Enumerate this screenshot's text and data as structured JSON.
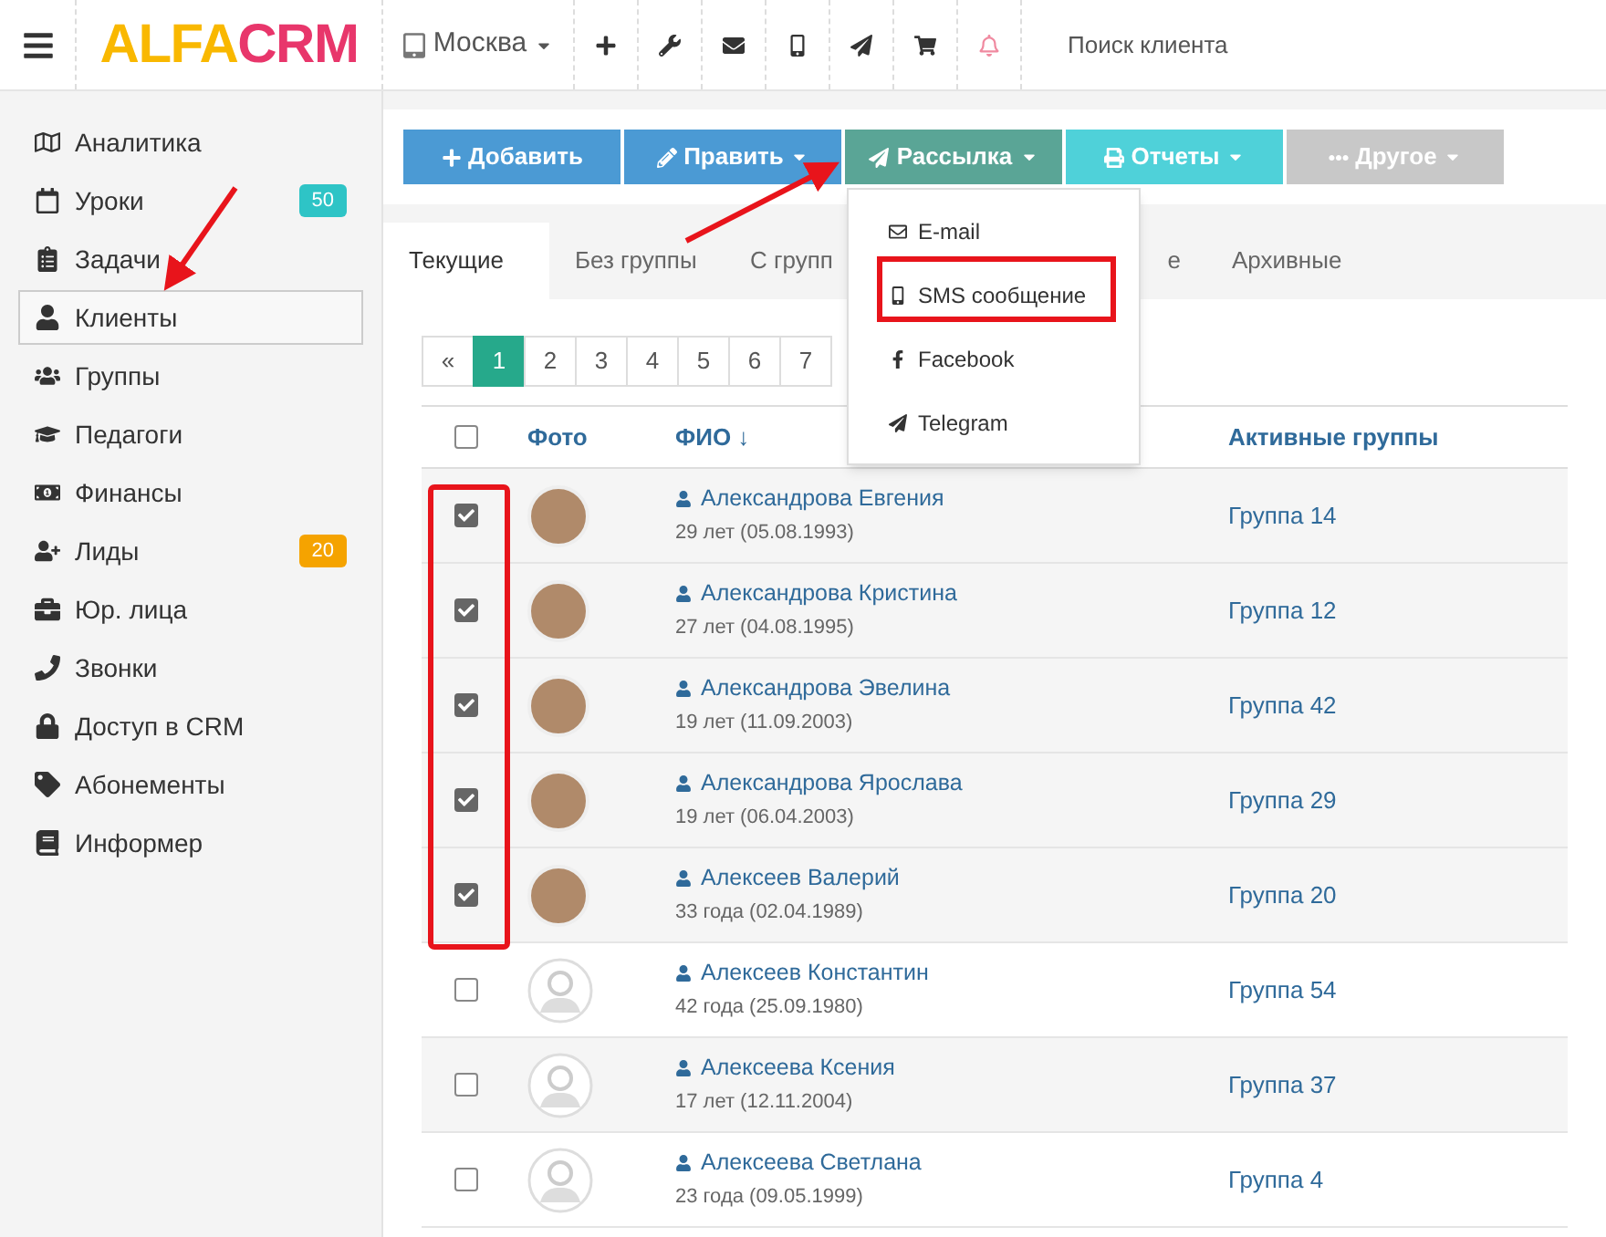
{
  "topbar": {
    "logo_left": "ALFA",
    "logo_right": "CRM",
    "branch": "Москва",
    "search": {
      "placeholder": "Поиск клиента"
    }
  },
  "sidebar": {
    "items": [
      {
        "label": "Аналитика",
        "selected": false
      },
      {
        "label": "Уроки",
        "selected": false,
        "badge": "50",
        "color": "#2ec4c6"
      },
      {
        "label": "Задачи",
        "selected": false
      },
      {
        "label": "Клиенты",
        "selected": true
      },
      {
        "label": "Группы",
        "selected": false
      },
      {
        "label": "Педагоги",
        "selected": false
      },
      {
        "label": "Финансы",
        "selected": false
      },
      {
        "label": "Лиды",
        "selected": false,
        "badge": "20",
        "color": "#f5a300"
      },
      {
        "label": "Юр. лица",
        "selected": false
      },
      {
        "label": "Звонки",
        "selected": false
      },
      {
        "label": "Доступ в CRM",
        "selected": false
      },
      {
        "label": "Абонементы",
        "selected": false
      },
      {
        "label": "Информер",
        "selected": false
      }
    ]
  },
  "toolbar": {
    "buttons": [
      {
        "label": "Добавить",
        "color": "#4b9ad4",
        "caret": false
      },
      {
        "label": "Править",
        "color": "#4b9ad4",
        "caret": true
      },
      {
        "label": "Рассылка",
        "color": "#5aa596",
        "caret": true
      },
      {
        "label": "Отчеты",
        "color": "#4fd1d9",
        "caret": true
      },
      {
        "label": "Другое",
        "color": "#c8c8c8",
        "caret": true
      }
    ]
  },
  "dropdown": {
    "items": [
      {
        "label": "E-mail"
      },
      {
        "label": "SMS сообщение"
      },
      {
        "label": "Facebook"
      },
      {
        "label": "Telegram"
      }
    ]
  },
  "tabs": [
    {
      "label": "Текущие",
      "selected": true
    },
    {
      "label": "Без группы",
      "selected": false
    },
    {
      "label": "С групп",
      "selected": false
    },
    {
      "label": "е",
      "selected": false
    },
    {
      "label": "Архивные",
      "selected": false
    }
  ],
  "pagination": [
    {
      "label": "«",
      "selected": false
    },
    {
      "label": "1",
      "selected": true
    },
    {
      "label": "2",
      "selected": false
    },
    {
      "label": "3",
      "selected": false
    },
    {
      "label": "4",
      "selected": false
    },
    {
      "label": "5",
      "selected": false
    },
    {
      "label": "6",
      "selected": false
    },
    {
      "label": "7",
      "selected": false
    }
  ],
  "table": {
    "select_all": {
      "checked": false
    },
    "columns": [
      "Фото",
      "ФИО ↓",
      "Активные группы"
    ],
    "rows": [
      {
        "checked": true,
        "kind": "photo",
        "name": "Александрова Евгения",
        "age": "29 лет (05.08.1993)",
        "group": "Группа 14"
      },
      {
        "checked": true,
        "kind": "photo",
        "name": "Александрова Кристина",
        "age": "27 лет (04.08.1995)",
        "group": "Группа 12"
      },
      {
        "checked": true,
        "kind": "photo",
        "name": "Александрова Эвелина",
        "age": "19 лет (11.09.2003)",
        "group": "Группа 42"
      },
      {
        "checked": true,
        "kind": "photo",
        "name": "Александрова Ярослава",
        "age": "19 лет (06.04.2003)",
        "group": "Группа 29"
      },
      {
        "checked": true,
        "kind": "photo",
        "name": "Алексеев Валерий",
        "age": "33 года (02.04.1989)",
        "group": "Группа 20"
      },
      {
        "checked": false,
        "kind": "default",
        "name": "Алексеев Константин",
        "age": "42 года (25.09.1980)",
        "group": "Группа 54"
      },
      {
        "checked": false,
        "kind": "default",
        "name": "Алексеева Ксения",
        "age": "17 лет (12.11.2004)",
        "group": "Группа 37"
      },
      {
        "checked": false,
        "kind": "default",
        "name": "Алексеева Светлана",
        "age": "23 года (09.05.1999)",
        "group": "Группа 4"
      }
    ]
  }
}
